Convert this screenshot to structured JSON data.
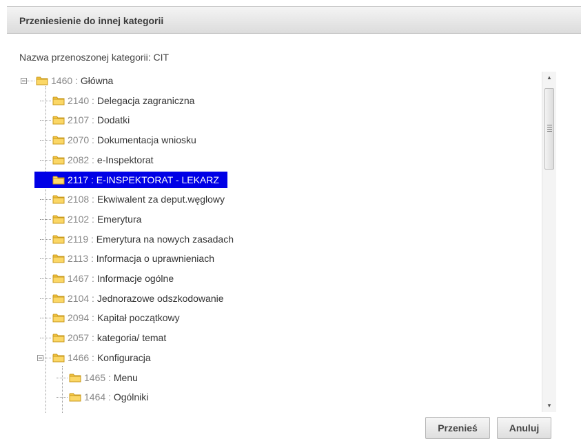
{
  "dialog": {
    "title": "Przeniesienie do innej kategorii",
    "subtitle": "Nazwa przenoszonej kategorii: CIT"
  },
  "tree": {
    "root": {
      "id": "1460",
      "label": "Główna",
      "expanded": true
    },
    "items": [
      {
        "id": "2140",
        "label": "Delegacja zagraniczna",
        "depth": 1
      },
      {
        "id": "2107",
        "label": "Dodatki",
        "depth": 1
      },
      {
        "id": "2070",
        "label": "Dokumentacja wniosku",
        "depth": 1
      },
      {
        "id": "2082",
        "label": "e-Inspektorat",
        "depth": 1
      },
      {
        "id": "2117",
        "label": "E-INSPEKTORAT - LEKARZ",
        "depth": 1,
        "selected": true
      },
      {
        "id": "2108",
        "label": "Ekwiwalent za deput.węglowy",
        "depth": 1
      },
      {
        "id": "2102",
        "label": "Emerytura",
        "depth": 1
      },
      {
        "id": "2119",
        "label": "Emerytura na nowych zasadach",
        "depth": 1
      },
      {
        "id": "2113",
        "label": "Informacja o uprawnieniach",
        "depth": 1
      },
      {
        "id": "1467",
        "label": "Informacje ogólne",
        "depth": 1
      },
      {
        "id": "2104",
        "label": "Jednorazowe odszkodowanie",
        "depth": 1
      },
      {
        "id": "2094",
        "label": "Kapitał początkowy",
        "depth": 1
      },
      {
        "id": "2057",
        "label": "kategoria/ temat",
        "depth": 1
      },
      {
        "id": "1466",
        "label": "Konfiguracja",
        "depth": 1,
        "expanded": true
      },
      {
        "id": "1465",
        "label": "Menu",
        "depth": 2
      },
      {
        "id": "1464",
        "label": "Ogólniki",
        "depth": 2
      }
    ],
    "separator": " : "
  },
  "buttons": {
    "move": "Przenieś",
    "cancel": "Anuluj"
  },
  "icons": {
    "folder": "folder-icon",
    "collapse": "collapse-toggle-icon",
    "scroll_up": "scroll-up-arrow-icon",
    "scroll_down": "scroll-down-arrow-icon"
  },
  "colors": {
    "selection": "#0000e6",
    "folder": "#f5c542"
  }
}
